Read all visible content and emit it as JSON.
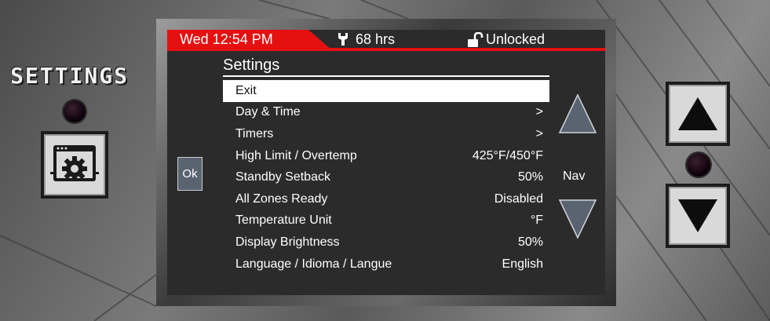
{
  "panel": {
    "label": "SETTINGS"
  },
  "status": {
    "datetime": "Wed 12:54 PM",
    "hours": "68 hrs",
    "lock_state": "Unlocked"
  },
  "menu": {
    "title": "Settings",
    "items": [
      {
        "label": "Exit",
        "value": "",
        "selected": true
      },
      {
        "label": "Day & Time",
        "value": ">"
      },
      {
        "label": "Timers",
        "value": ">"
      },
      {
        "label": "High Limit / Overtemp",
        "value": "425°F/450°F"
      },
      {
        "label": "Standby Setback",
        "value": "50%"
      },
      {
        "label": "All Zones Ready",
        "value": "Disabled"
      },
      {
        "label": "Temperature Unit",
        "value": "°F"
      },
      {
        "label": "Display Brightness",
        "value": "50%"
      },
      {
        "label": "Language / Idioma / Langue",
        "value": "English"
      }
    ]
  },
  "controls": {
    "ok_label": "Ok",
    "nav_label": "Nav"
  },
  "colors": {
    "status_red": "#e51010",
    "screen_bg": "#2b2b2b",
    "selected_bg": "#ffffff",
    "ok_button": "#5a6470",
    "nav_arrow": "#5a6470"
  },
  "icons": {
    "hours": "wrench-icon",
    "lock": "unlocked-padlock-icon",
    "settings_button": "settings-gear-window-icon",
    "up": "up-arrow-icon",
    "down": "down-arrow-icon"
  }
}
